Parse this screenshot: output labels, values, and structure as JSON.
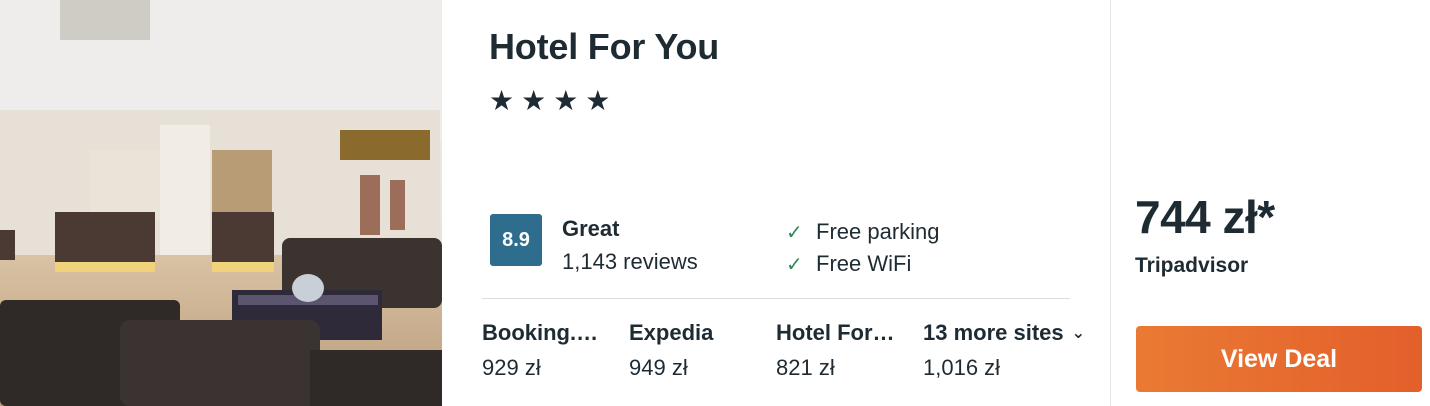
{
  "hotel": {
    "name": "Hotel For You",
    "stars_display": "★★★★",
    "star_count": 4
  },
  "rating": {
    "score": "8.9",
    "label": "Great",
    "reviews": "1,143 reviews"
  },
  "amenities": [
    {
      "label": "Free parking",
      "icon": "check-icon"
    },
    {
      "label": "Free WiFi",
      "icon": "check-icon"
    }
  ],
  "sites": [
    {
      "name": "Booking.…",
      "price": "929 zł"
    },
    {
      "name": "Expedia",
      "price": "949 zł"
    },
    {
      "name": "Hotel For…",
      "price": "821 zł"
    },
    {
      "name": "13 more sites",
      "price": "1,016 zł",
      "icon": "chevron-down-icon"
    }
  ],
  "deal": {
    "price": "744 zł*",
    "provider": "Tripadvisor",
    "button_label": "View Deal"
  },
  "colors": {
    "rating_badge": "#2f6d8e",
    "check": "#2e8b57",
    "deal_button": "#e8692e",
    "text": "#1f2b33"
  }
}
